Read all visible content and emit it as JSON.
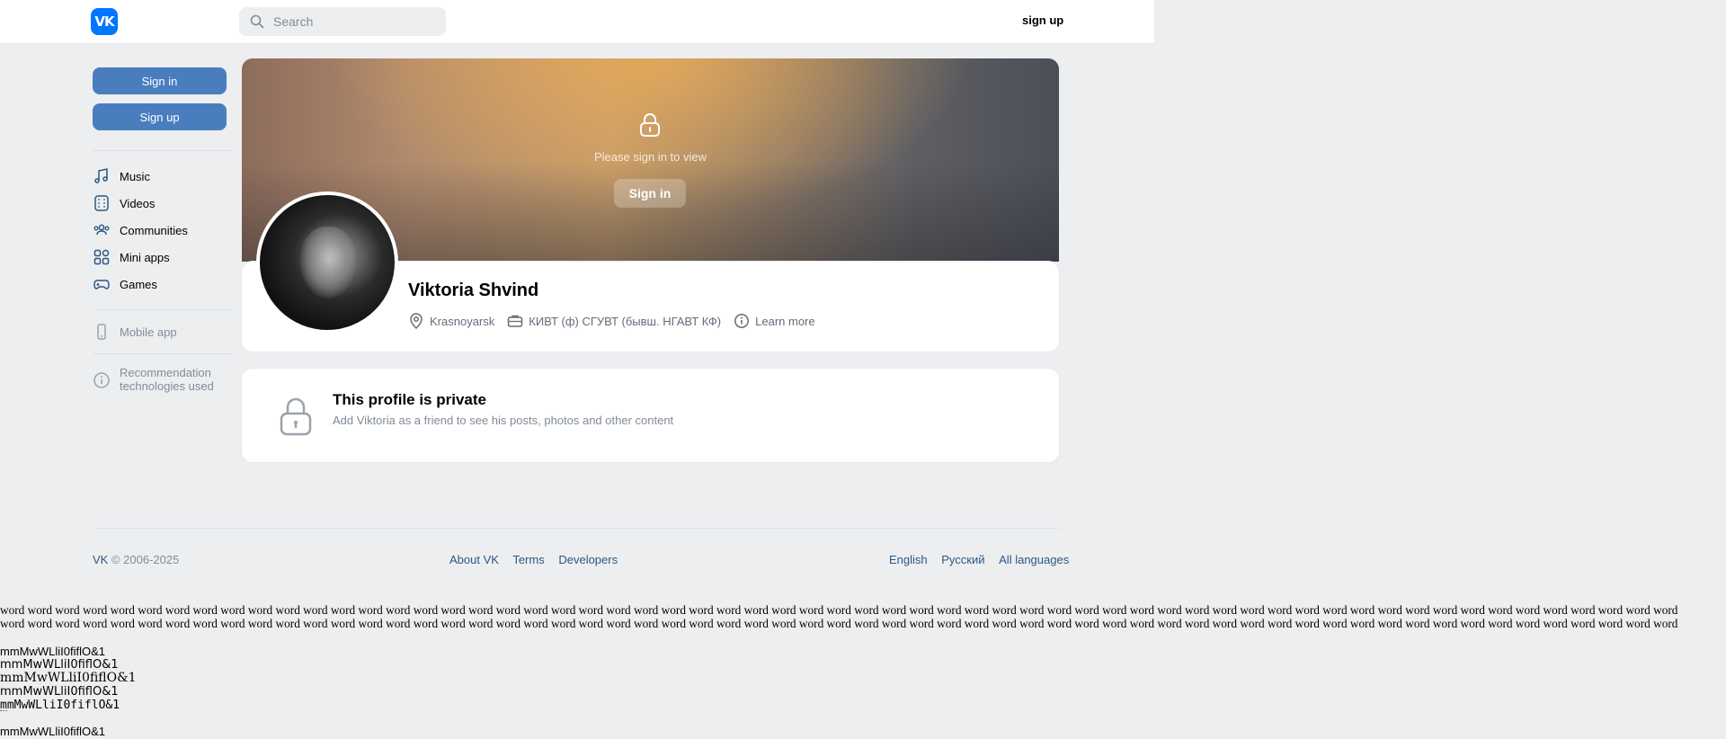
{
  "header": {
    "logo_text": "VK",
    "search_placeholder": "Search",
    "signup_label": "sign up"
  },
  "sidebar": {
    "signin_label": "Sign in",
    "signup_label": "Sign up",
    "items": [
      {
        "label": "Music",
        "icon": "music-icon"
      },
      {
        "label": "Videos",
        "icon": "videos-icon"
      },
      {
        "label": "Communities",
        "icon": "communities-icon"
      },
      {
        "label": "Mini apps",
        "icon": "mini-apps-icon"
      },
      {
        "label": "Games",
        "icon": "games-icon"
      }
    ],
    "mobile_app_label": "Mobile app",
    "recommendation_label": "Recommendation technologies used"
  },
  "profile": {
    "cover_text": "Please sign in to view",
    "cover_button": "Sign in",
    "name": "Viktoria Shvind",
    "city": "Krasnoyarsk",
    "work": "КИВТ (ф) СГУВТ (бывш. НГАВТ КФ)",
    "learn_more": "Learn more"
  },
  "private_card": {
    "title": "This profile is private",
    "subtitle": "Add Viktoria as a friend to see his posts, photos and other content"
  },
  "footer": {
    "brand": "VK",
    "copyright": "© 2006-2025",
    "links": [
      "About VK",
      "Terms",
      "Developers"
    ],
    "languages": [
      "English",
      "Русский",
      "All languages"
    ]
  },
  "test_text": {
    "words_line1": "word word word word word word word word word word word word word word word word word word word word word word word word word word word word word word word word word word word word word word word word word word word word word word word word word word word word word word word word word word word word word",
    "words_line2": "word word word word word word word word word word word word word word word word word word word word word word word word word word word word word word word word word word word word word word word word word word word word word word word word word word word word word word word word word word word word word",
    "specimen_lines": [
      "mmMwWLliI0fiflO&1",
      "mmMwWLliI0fiflO&1",
      "mmMwWLliI0fiflO&1",
      "mmMwWLliI0fiflO&1",
      "mmMwWLliI0fiflO&1",
      "mmMwWLliI0fiflO&1"
    ]
  },
  "colors": {
    "accent": "#4a7dbe",
    "brand": "#0077ff",
    "background": "#edeef0",
    "link": "#2a5885"
  }
}
